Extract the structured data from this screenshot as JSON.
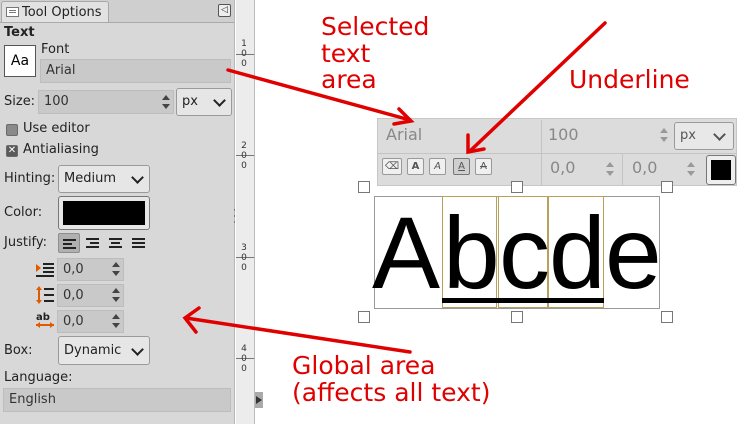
{
  "panel": {
    "tab_label": "Tool Options",
    "section_title": "Text",
    "font_label": "Font",
    "font_preview": "Aa",
    "font_value": "Arial",
    "size_label": "Size:",
    "size_value": "100",
    "size_unit": "px",
    "use_editor_label": "Use editor",
    "antialiasing_label": "Antialiasing",
    "hinting_label": "Hinting:",
    "hinting_value": "Medium",
    "color_label": "Color:",
    "text_color": "#000000",
    "justify_label": "Justify:",
    "indent_value": "0,0",
    "line_spacing_value": "0,0",
    "letter_spacing_value": "0,0",
    "box_label": "Box:",
    "box_value": "Dynamic",
    "language_label": "Language:",
    "language_value": "English"
  },
  "ruler": {
    "marks": [
      "1",
      "0",
      "0",
      "2",
      "0",
      "0",
      "3",
      "0",
      "0",
      "4",
      "0",
      "0"
    ]
  },
  "floating_toolbar": {
    "font_value": "Arial",
    "size_value": "100",
    "unit_value": "px",
    "baseline_value": "0,0",
    "kerning_value": "0,0",
    "style_buttons": [
      "A",
      "A",
      "A",
      "A"
    ]
  },
  "canvas_text": {
    "letters": [
      "A",
      "b",
      "c",
      "d",
      "e"
    ]
  },
  "annotations": {
    "selected_line1": "Selected",
    "selected_line2": "text",
    "selected_line3": "area",
    "underline": "Underline",
    "global_line1": "Global area",
    "global_line2": "(affects all text)",
    "color": "#e00000"
  }
}
